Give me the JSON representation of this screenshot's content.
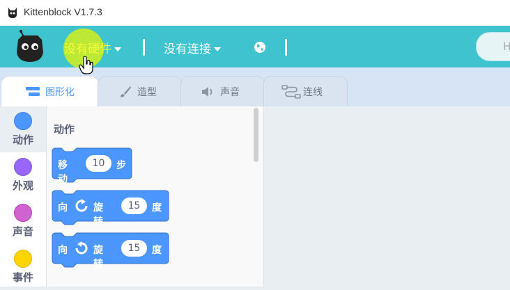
{
  "window": {
    "title": "Kittenblock V1.7.3"
  },
  "menubar": {
    "hardware_label": "没有硬件",
    "connect_label": "没有连接",
    "right_pill_text": "H",
    "accent": "#3fc3cf"
  },
  "tabs": [
    {
      "label": "图形化",
      "icon": "blocks-icon",
      "active": true
    },
    {
      "label": "造型",
      "icon": "brush-icon",
      "active": false
    },
    {
      "label": "声音",
      "icon": "speaker-icon",
      "active": false
    },
    {
      "label": "连线",
      "icon": "wire-icon",
      "active": false
    }
  ],
  "categories": [
    {
      "label": "动作",
      "color": "#4c97ff",
      "active": true
    },
    {
      "label": "外观",
      "color": "#9966ff",
      "active": false
    },
    {
      "label": "声音",
      "color": "#cf63cf",
      "active": false
    },
    {
      "label": "事件",
      "color": "#ffd500",
      "active": false
    }
  ],
  "palette": {
    "section_title": "动作",
    "block_color": "#4c97ff",
    "blocks": [
      {
        "parts": [
          "移动",
          "10",
          "步"
        ]
      },
      {
        "parts": [
          "向",
          "turn-right-icon",
          "旋转",
          "15",
          "度"
        ]
      },
      {
        "parts": [
          "向",
          "turn-left-icon",
          "旋转",
          "15",
          "度"
        ]
      }
    ]
  }
}
